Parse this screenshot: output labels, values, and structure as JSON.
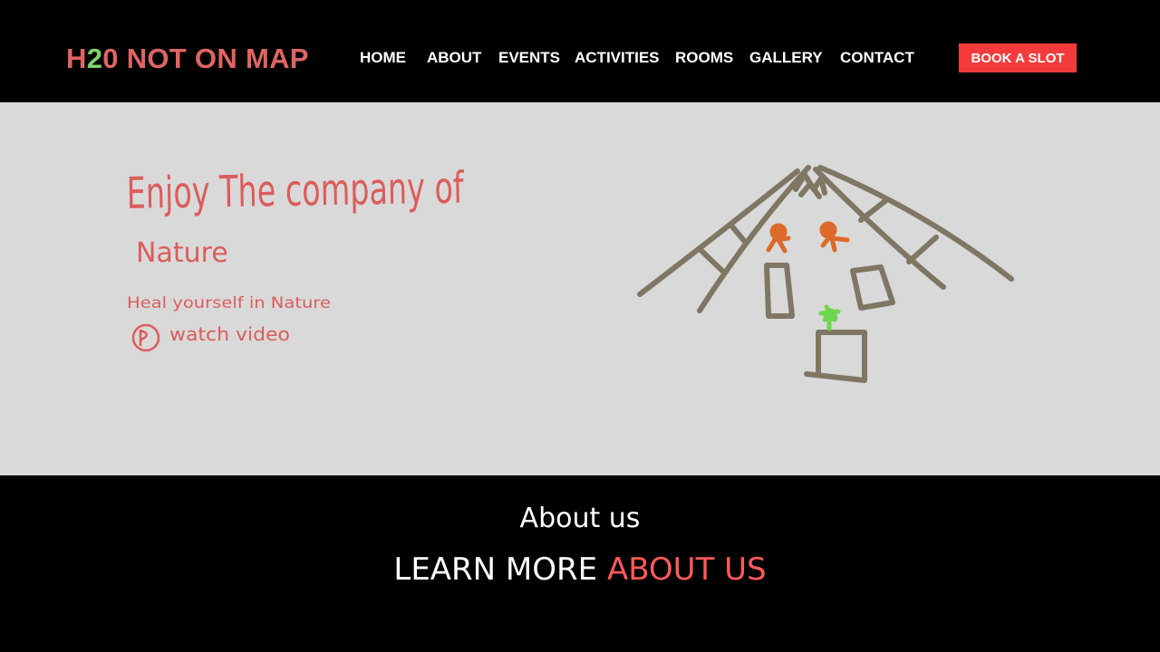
{
  "header": {
    "logo": {
      "part1": "H",
      "part2": "2",
      "part3": "0 NOT ON MAP"
    },
    "nav": [
      "HOME",
      "ABOUT",
      "EVENTS",
      "ACTIVITIES",
      "ROOMS",
      "GALLERY",
      "CONTACT"
    ],
    "cta_label": "BOOK A SLOT"
  },
  "hero": {
    "headline_line1": "Enjoy The company of",
    "headline_line2": "Nature",
    "tagline": "Heal yourself in Nature",
    "watch_label": "watch video",
    "illustration": "tent-with-people-sketch"
  },
  "about": {
    "subtitle": "About us",
    "title_prefix": "LEARN MORE ",
    "title_accent": "ABOUT US"
  },
  "colors": {
    "logo": "#e06464",
    "logo_accent": "#7fd36b",
    "cta_bg": "#f43b3b",
    "hero_bg": "#d9d9d9",
    "handwriting": "#dc5c5c",
    "sketch": "#7f7663",
    "sketch_people": "#dd6a2a",
    "sketch_plant": "#6fd64f",
    "about_accent": "#ff5a5a"
  }
}
